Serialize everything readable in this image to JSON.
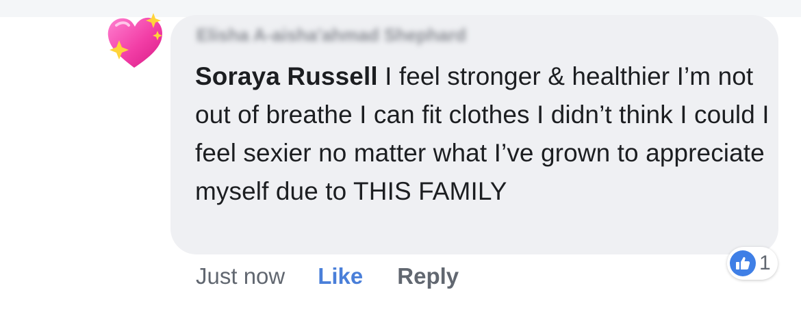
{
  "comment": {
    "reply_to_name": "Elisha A-aisha'ahmad Shephard",
    "author": "Soraya Russell",
    "text": " I feel stronger & healthier I’m not out of breathe I can fit clothes I didn’t think I could  I feel sexier no matter what I’ve grown to appreciate myself due to THIS FAMILY",
    "avatar_icon": "sparkling-heart-icon"
  },
  "actions": {
    "timestamp": "Just now",
    "like_label": "Like",
    "reply_label": "Reply"
  },
  "reactions": {
    "icon": "thumbs-up-icon",
    "count": "1"
  },
  "colors": {
    "bubble": "#eff0f3",
    "link_blue": "#4a7fd9",
    "like_badge": "#3f7fe6",
    "text": "#1c1e21",
    "muted": "#616770"
  }
}
